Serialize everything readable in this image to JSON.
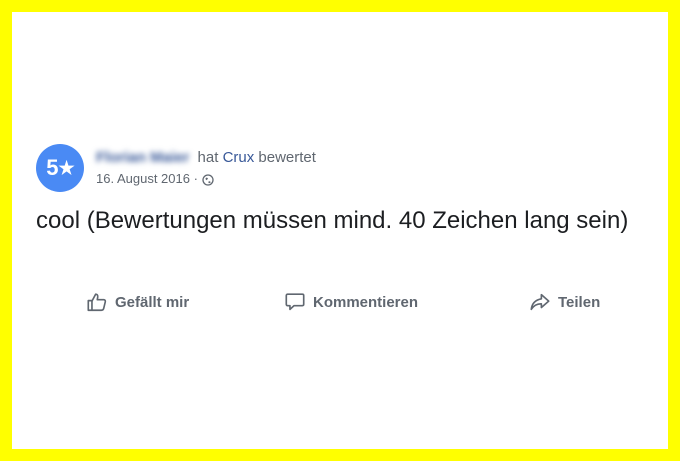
{
  "review": {
    "rating": "5",
    "reviewer_name": "Florian Maier",
    "action_text": "hat",
    "page_name": "Crux",
    "action_suffix": "bewertet",
    "date": "16. August 2016",
    "separator": "·",
    "privacy_icon": "globe-icon",
    "text": "cool (Bewertungen müssen mind. 40 Zeichen lang sein)"
  },
  "actions": {
    "like_label": "Gefällt mir",
    "like_icon": "thumbs-up-icon",
    "comment_label": "Kommentieren",
    "comment_icon": "comment-icon",
    "share_label": "Teilen",
    "share_icon": "share-icon"
  },
  "colors": {
    "frame": "#ffff00",
    "badge": "#4a8af4",
    "link": "#385898",
    "secondary_text": "#606770",
    "primary_text": "#1c1e21"
  }
}
